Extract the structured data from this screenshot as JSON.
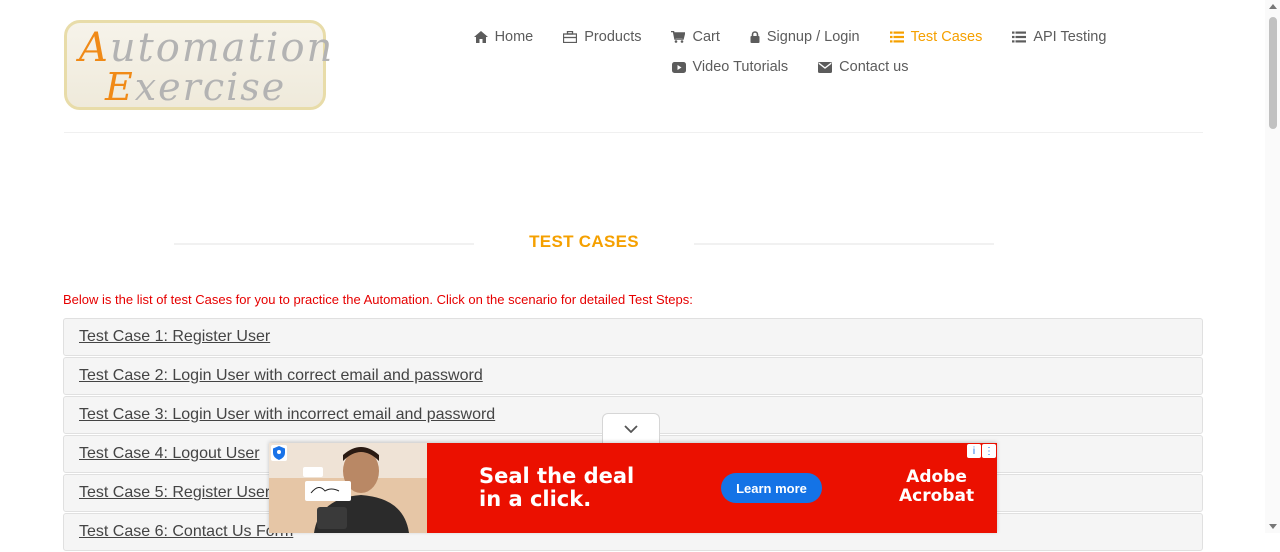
{
  "logo": {
    "line1_cap": "A",
    "line1_rest": "utomation",
    "line2_cap": "E",
    "line2_rest": "xercise"
  },
  "nav": {
    "row1": [
      {
        "label": "Home",
        "icon": "home-icon"
      },
      {
        "label": "Products",
        "icon": "briefcase-icon"
      },
      {
        "label": "Cart",
        "icon": "cart-icon"
      },
      {
        "label": "Signup / Login",
        "icon": "lock-icon"
      },
      {
        "label": "Test Cases",
        "icon": "list-icon",
        "active": true
      },
      {
        "label": "API Testing",
        "icon": "list-icon"
      }
    ],
    "row2": [
      {
        "label": "Video Tutorials",
        "icon": "youtube-icon"
      },
      {
        "label": "Contact us",
        "icon": "envelope-icon"
      }
    ]
  },
  "page": {
    "title": "TEST CASES",
    "intro": "Below is the list of test Cases for you to practice the Automation. Click on the scenario for detailed Test Steps:"
  },
  "test_cases": [
    "Test Case 1: Register User",
    "Test Case 2: Login User with correct email and password",
    "Test Case 3: Login User with incorrect email and password",
    "Test Case 4: Logout User",
    "Test Case 5: Register User",
    "Test Case 6: Contact Us Form"
  ],
  "ad": {
    "headline_line1": "Seal the deal",
    "headline_line2": "in a click.",
    "cta": "Learn more",
    "brand_line1": "Adobe",
    "brand_line2": "Acrobat",
    "info_glyph": "i",
    "more_glyph": "⋮"
  },
  "colors": {
    "accent": "#f5a000",
    "intro_red": "#e60000",
    "ad_red": "#eb1000",
    "ad_button": "#1473e6"
  }
}
